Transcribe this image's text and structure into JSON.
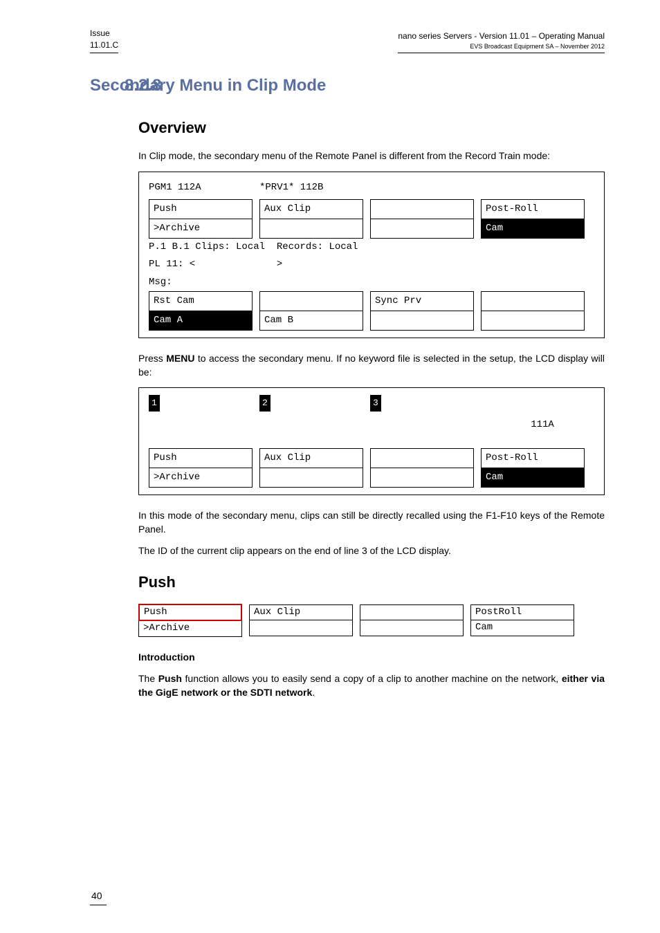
{
  "header": {
    "issue_label": "Issue",
    "issue_value": "11.01.C",
    "title_right_1": "nano series Servers - Version 11.01 – Operating Manual",
    "title_right_2": "EVS Broadcast Equipment SA – November 2012"
  },
  "section_number": "8.2.8",
  "section_title": "Secondary Menu in Clip Mode",
  "overview": {
    "heading": "Overview",
    "intro": "In Clip mode, the secondary menu of the Remote Panel is different from the Record Train mode:",
    "panel1": {
      "hdr_left": "PGM1 112A",
      "hdr_right": "*PRV1* 112B",
      "push": "Push",
      "aux_clip": "Aux Clip",
      "post_roll": "Post-Roll",
      "archive": ">Archive",
      "cam": "Cam",
      "line_clips": "P.1 B.1 Clips: Local  Records: Local",
      "line_pl": "PL 11: <              >",
      "line_msg": "Msg:",
      "rst_cam": "Rst Cam",
      "sync_prv": "Sync Prv",
      "cam_a": "Cam A",
      "cam_b": "Cam B"
    },
    "mid_para_1": "Press ",
    "mid_para_bold": "MENU",
    "mid_para_2": " to access the secondary menu. If no keyword file is selected in the setup, the LCD display will be:",
    "panel2": {
      "n1": "1",
      "n2": "2",
      "n3": "3",
      "id": "111A",
      "push": "Push",
      "aux_clip": "Aux Clip",
      "post_roll": "Post-Roll",
      "archive": ">Archive",
      "cam": "Cam"
    },
    "after_para1": "In this mode of the secondary menu, clips can still be directly recalled using the F1-F10 keys of the Remote Panel.",
    "after_para2": "The ID of the current clip appears on the end of line 3 of the LCD display."
  },
  "push": {
    "heading": "Push",
    "panel": {
      "push": "Push",
      "aux_clip": "Aux Clip",
      "post_roll": "PostRoll",
      "archive": ">Archive",
      "cam": "Cam"
    },
    "intro_heading": "Introduction",
    "para_1": "The ",
    "para_bold1": "Push",
    "para_2": " function allows you to easily send a copy of a clip to another machine on the network, ",
    "para_bold2": "either via the GigE network or the SDTI network",
    "para_3": "."
  },
  "footer_page": "40"
}
